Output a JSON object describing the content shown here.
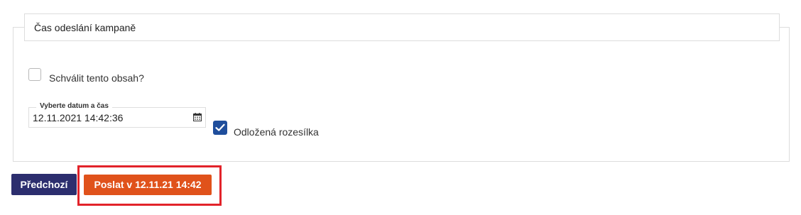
{
  "section": {
    "title": "Čas odeslání kampaně"
  },
  "approve": {
    "label": "Schválit tento obsah?",
    "checked": false
  },
  "datetime": {
    "legend": "Vyberte datum a čas",
    "value": "12.11.2021 14:42:36",
    "icon": "calendar-icon"
  },
  "deferred": {
    "label": "Odložená rozesílka",
    "checked": true,
    "color": "#1f4e9c"
  },
  "buttons": {
    "previous_label": "Předchozí",
    "previous_color": "#2c2e6e",
    "send_label": "Poslat v 12.11.21 14:42",
    "send_color": "#e0521b"
  },
  "highlight_color": "#e2232a"
}
